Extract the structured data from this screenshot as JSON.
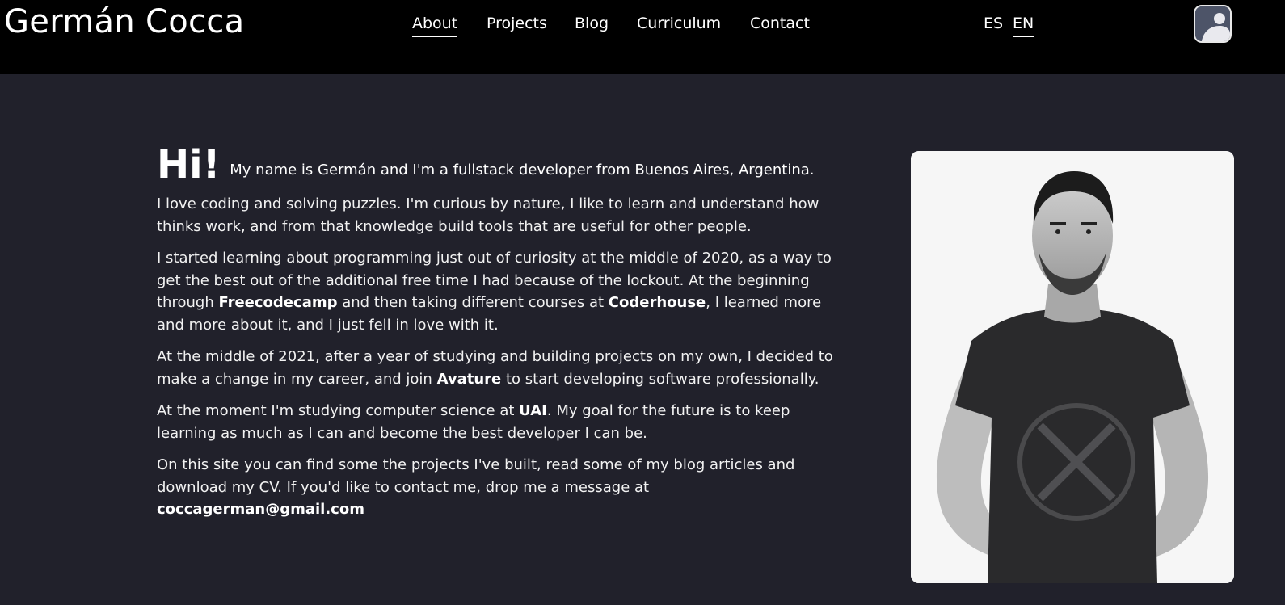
{
  "header": {
    "brand": "Germán Cocca",
    "nav": [
      {
        "label": "About",
        "active": true
      },
      {
        "label": "Projects",
        "active": false
      },
      {
        "label": "Blog",
        "active": false
      },
      {
        "label": "Curriculum",
        "active": false
      },
      {
        "label": "Contact",
        "active": false
      }
    ],
    "languages": [
      {
        "label": "ES",
        "active": false
      },
      {
        "label": "EN",
        "active": true
      }
    ],
    "avatar_icon": "user-avatar-icon"
  },
  "about": {
    "greeting": "Hi!",
    "intro": "My name is Germán and I'm a fullstack developer from Buenos Aires, Argentina.",
    "p1": "I love coding and solving puzzles. I'm curious by nature, I like to learn and understand how thinks work, and from that knowledge build tools that are useful for other people.",
    "p2": {
      "a": "I started learning about programming just out of curiosity at the middle of 2020, as a way to get the best out of the additional free time I had because of the lockout. At the beginning through ",
      "b1": "Freecodecamp",
      "c": " and then taking different courses at ",
      "b2": "Coderhouse",
      "d": ", I learned more and more about it, and I just fell in love with it."
    },
    "p3": {
      "a": "At the middle of 2021, after a year of studying and building projects on my own, I decided to make a change in my career, and join ",
      "b": "Avature",
      "c": " to start developing software professionally."
    },
    "p4": {
      "a": "At the moment I'm studying computer science at ",
      "b": "UAI",
      "c": ". My goal for the future is to keep learning as much as I can and become the best developer I can be."
    },
    "p5": {
      "a": "On this site you can find some the projects I've built, read some of my blog articles and download my CV. If you'd like to contact me, drop me a message at",
      "email": "coccagerman@gmail.com"
    }
  },
  "colors": {
    "header_bg": "#000000",
    "page_bg": "#21212b",
    "text": "#ffffff"
  }
}
